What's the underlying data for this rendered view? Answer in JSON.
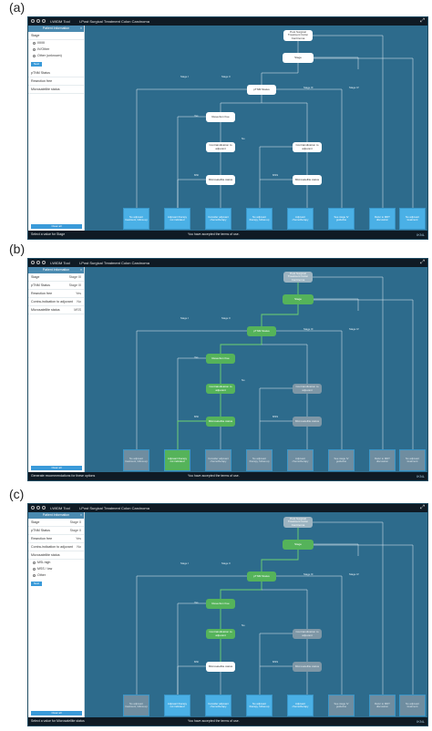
{
  "panels": [
    {
      "label": "(a)",
      "app_name": "i-WIDM Tool",
      "title": "i-Post Surgical Treatment Colon Carcinoma",
      "sidebar": {
        "header": "Patient Information",
        "rows": [
          {
            "label": "Stage",
            "value": ""
          },
          {
            "label": "pTNM Status",
            "value": ""
          },
          {
            "label": "Resection free",
            "value": ""
          },
          {
            "label": "Microsatellite status",
            "value": ""
          }
        ],
        "options": [
          "I/II/III",
          "IV/Other",
          "Other (unknown)"
        ],
        "next_label": "Next",
        "footer_button": "Clear all"
      },
      "footer": {
        "left": "Select a value for Stage",
        "center": "You have accepted the terms of use.",
        "right": "IKNL"
      }
    },
    {
      "label": "(b)",
      "app_name": "i-WIDM Tool",
      "title": "i-Post Surgical Treatment Colon Carcinoma",
      "sidebar": {
        "header": "Patient Information",
        "rows": [
          {
            "label": "Stage",
            "value": "Stage III"
          },
          {
            "label": "pTNM Status",
            "value": "Stage III"
          },
          {
            "label": "Resection free",
            "value": "Yes"
          },
          {
            "label": "Contra-indication to adjuvant",
            "value": "No"
          },
          {
            "label": "Microsatellite status",
            "value": "MSS"
          }
        ],
        "options": [],
        "next_label": "",
        "footer_button": "Clear all"
      },
      "footer": {
        "left": "Generate recommendations for these options",
        "center": "You have accepted the terms of use.",
        "right": "IKNL"
      }
    },
    {
      "label": "(c)",
      "app_name": "i-WIDM Tool",
      "title": "i-Post Surgical Treatment Colon Carcinoma",
      "sidebar": {
        "header": "Patient Information",
        "rows": [
          {
            "label": "Stage",
            "value": "Stage II"
          },
          {
            "label": "pTNM Status",
            "value": "Stage II"
          },
          {
            "label": "Resection free",
            "value": "Yes"
          },
          {
            "label": "Contra-indication to adjuvant",
            "value": "No"
          },
          {
            "label": "Microsatellite status",
            "value": ""
          }
        ],
        "options": [
          "MSI-high",
          "MSS / low",
          "Other"
        ],
        "next_label": "Next",
        "footer_button": "Clear all"
      },
      "footer": {
        "left": "Select a value for Microsatellite status",
        "center": "You have accepted the terms of use.",
        "right": "IKNL"
      }
    }
  ],
  "flow": {
    "top_node": "Post Surgical Treatment Colon Carcinoma",
    "stage_node": "Stage",
    "ptnm_node": "pTNM Status",
    "resection_node": "Resection free",
    "contra_left": "Contraindication to adjuvant",
    "contra_right": "Contraindication to adjuvant",
    "micro_left": "Microsatellite status",
    "micro_right": "Microsatellite status",
    "other_label": "Other / unknown",
    "edge_labels": {
      "i_iii": "I-III",
      "iv": "IV",
      "stage_i": "Stage I",
      "stage_ii": "Stage II",
      "stage_iii": "Stage III",
      "stage_iv": "Stage IV",
      "yes": "Yes",
      "no": "No",
      "msi": "MSI",
      "mss": "MSS"
    },
    "outcomes": [
      "No adjuvant treatment, follow-up",
      "Adjuvant therapy not indicated",
      "Consider adjuvant chemotherapy",
      "No adjuvant therapy, follow-up",
      "Adjuvant chemotherapy",
      "See stage IV guideline",
      "Refer to MDT discussion",
      "No adjuvant treatment"
    ]
  }
}
